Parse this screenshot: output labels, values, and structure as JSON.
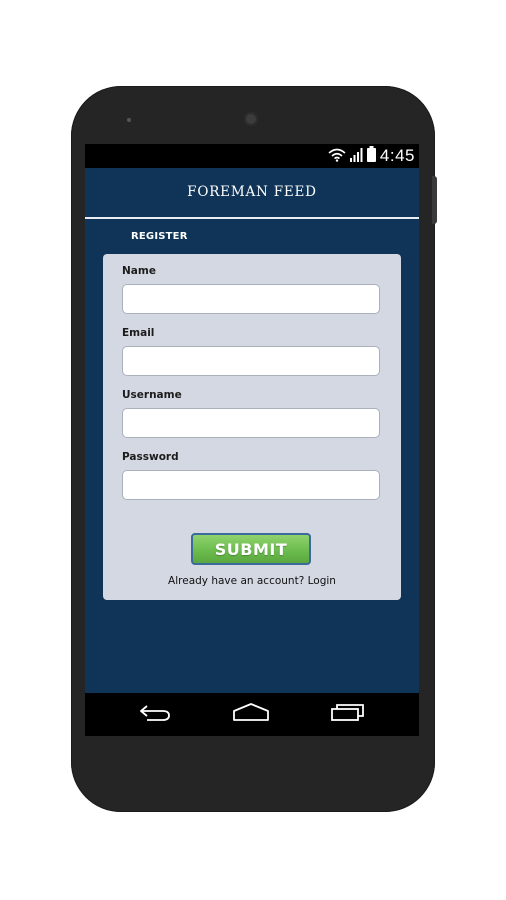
{
  "status_bar": {
    "time": "4:45",
    "icons": [
      "wifi-icon",
      "signal-icon",
      "battery-icon"
    ]
  },
  "header": {
    "title": "FOREMAN FEED"
  },
  "form": {
    "section_title": "REGISTER",
    "fields": [
      {
        "label": "Name",
        "value": "",
        "placeholder": ""
      },
      {
        "label": "Email",
        "value": "",
        "placeholder": ""
      },
      {
        "label": "Username",
        "value": "",
        "placeholder": ""
      },
      {
        "label": "Password",
        "value": "",
        "placeholder": ""
      }
    ],
    "submit_label": "SUBMIT",
    "login_link": "Already have an account? Login"
  },
  "nav_bar": {
    "icons": [
      "back-icon",
      "home-icon",
      "recent-apps-icon"
    ]
  },
  "colors": {
    "app_background": "#0f3457",
    "card_background": "#d4d8e3",
    "submit_green": "#6cbc4e",
    "submit_border": "#3c6a9a"
  }
}
